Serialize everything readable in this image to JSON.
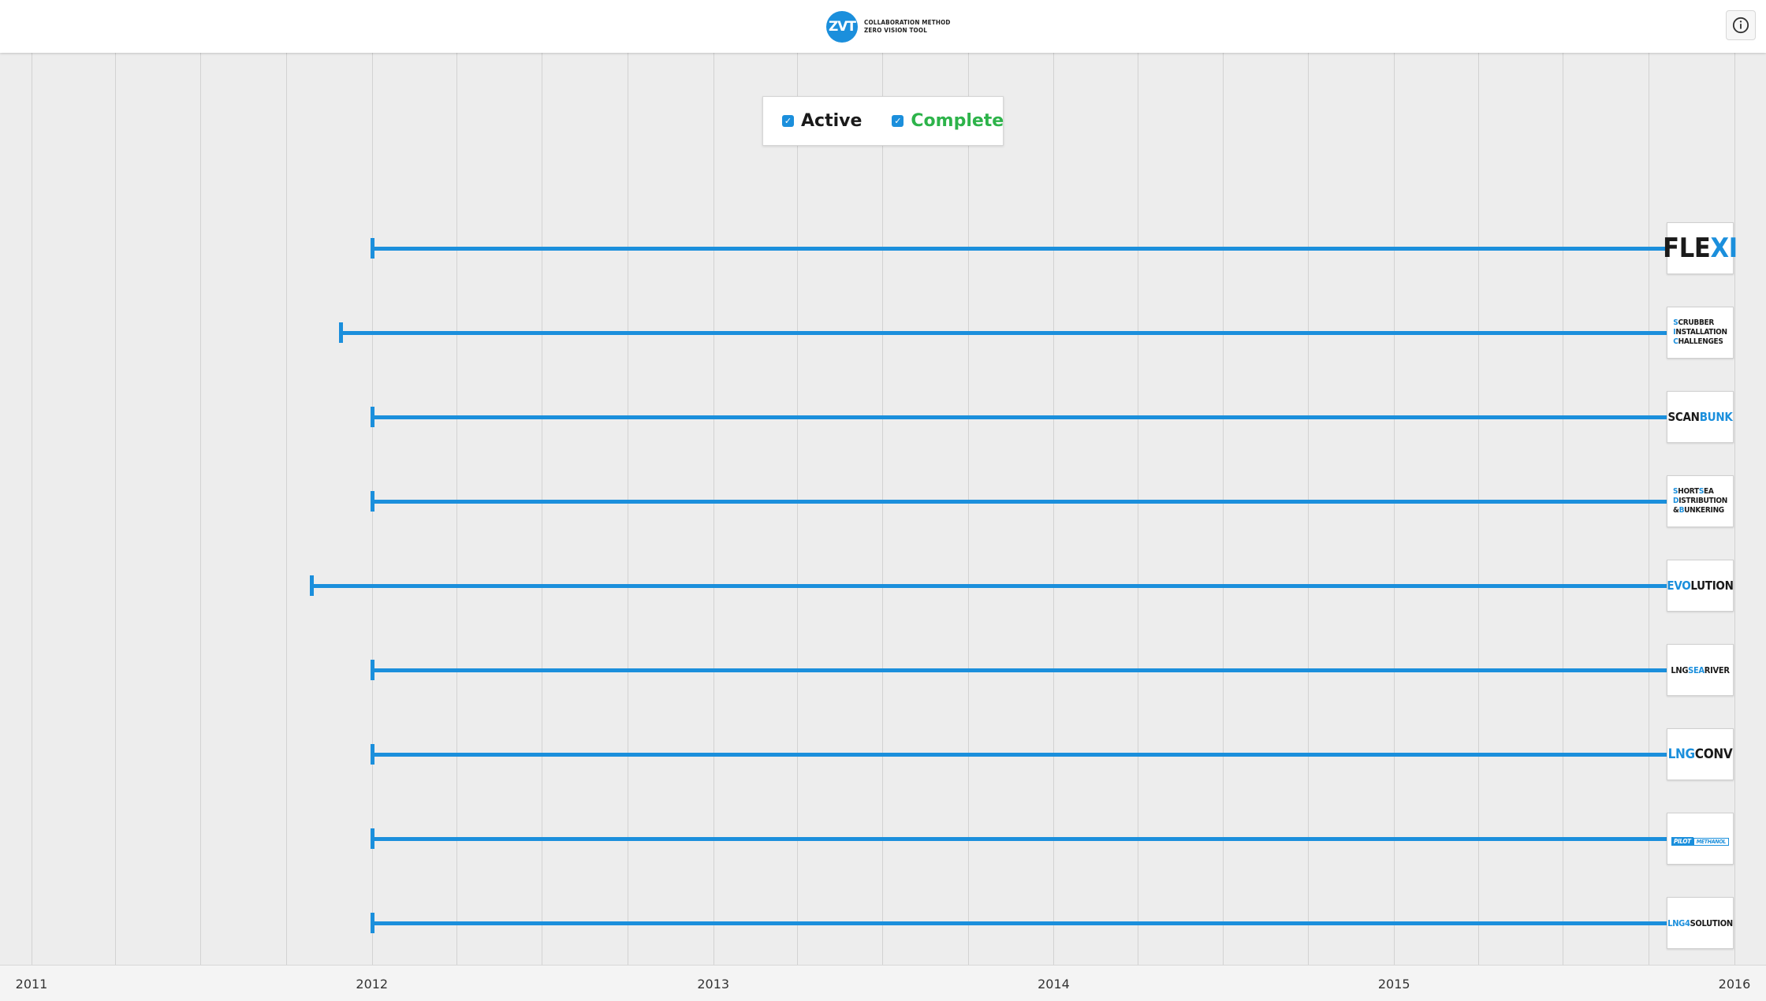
{
  "header": {
    "logo_mark": "ZVT",
    "logo_line1": "COLLABORATION METHOD",
    "logo_line2": "ZERO VISION TOOL",
    "info_icon": "info-icon"
  },
  "legend": {
    "items": [
      {
        "label": "Active",
        "checked": true,
        "color": "#1a1a1a"
      },
      {
        "label": "Complete",
        "checked": true,
        "color": "#2db34a"
      }
    ]
  },
  "colors": {
    "accent": "#1b8fdc",
    "complete": "#2db34a",
    "background": "#ededed"
  },
  "chart_data": {
    "type": "timeline",
    "x_axis": {
      "ticks": [
        "2011",
        "2012",
        "2013",
        "2014",
        "2015",
        "2016"
      ],
      "range": [
        "2011-01-01",
        "2016-01-01"
      ]
    },
    "grid": true,
    "legend_position": "top-center",
    "projects": [
      {
        "name": "FLEXI",
        "start": "2012-01-01",
        "end": "2015-10-25",
        "status": "active"
      },
      {
        "name": "SCRUBBER INSTALLATION CHALLENGES",
        "start": "2011-11-28",
        "end": "2015-10-25",
        "status": "active"
      },
      {
        "name": "SCANBUNK",
        "start": "2012-01-01",
        "end": "2015-10-25",
        "status": "active"
      },
      {
        "name": "SHORTSEA DISTRIBUTION & BUNKERING",
        "start": "2012-01-01",
        "end": "2015-10-25",
        "status": "active"
      },
      {
        "name": "EVOLUTION",
        "start": "2011-10-28",
        "end": "2015-10-25",
        "status": "active"
      },
      {
        "name": "LNGSEARIVER",
        "start": "2012-01-01",
        "end": "2015-10-25",
        "status": "active"
      },
      {
        "name": "LNGCONV",
        "start": "2012-01-01",
        "end": "2015-10-25",
        "status": "active"
      },
      {
        "name": "PILOT METHANOL",
        "start": "2012-01-01",
        "end": "2015-10-25",
        "status": "active"
      },
      {
        "name": "LNG4SOLUTION",
        "start": "2012-01-01",
        "end": "2015-10-25",
        "status": "active"
      }
    ]
  },
  "badges": [
    {
      "parts": [
        [
          "FLE",
          ""
        ],
        [
          "XI",
          "hl"
        ]
      ]
    },
    {
      "lines": [
        [
          [
            "S",
            "hl"
          ],
          [
            "CRUBBER",
            ""
          ]
        ],
        [
          [
            "I",
            "hl"
          ],
          [
            "NSTALLATION",
            ""
          ]
        ],
        [
          [
            "C",
            "hl"
          ],
          [
            "HALLENGES",
            ""
          ]
        ]
      ]
    },
    {
      "parts": [
        [
          "SCAN",
          ""
        ],
        [
          "BUNK",
          "hl"
        ]
      ]
    },
    {
      "lines": [
        [
          [
            "S",
            "hl"
          ],
          [
            "HORT",
            ""
          ],
          [
            "S",
            "hl"
          ],
          [
            "EA",
            ""
          ]
        ],
        [
          [
            "D",
            "hl"
          ],
          [
            "ISTRIBUTION",
            ""
          ]
        ],
        [
          [
            "&",
            ""
          ],
          [
            "B",
            "hl"
          ],
          [
            "UNKERING",
            ""
          ]
        ]
      ]
    },
    {
      "parts": [
        [
          "EVO",
          "hl"
        ],
        [
          "LUTION",
          ""
        ]
      ]
    },
    {
      "parts": [
        [
          "LNG",
          ""
        ],
        [
          "SEA",
          "hl"
        ],
        [
          "RIVER",
          ""
        ]
      ]
    },
    {
      "parts": [
        [
          "LNG",
          "hl"
        ],
        [
          "CONV",
          ""
        ]
      ]
    },
    {
      "parts": [
        [
          "PILOT",
          "pilot"
        ],
        [
          "METHANOL",
          "meth"
        ]
      ]
    },
    {
      "parts": [
        [
          "LNG4",
          "hl"
        ],
        [
          "SOLUTION",
          ""
        ]
      ]
    }
  ]
}
